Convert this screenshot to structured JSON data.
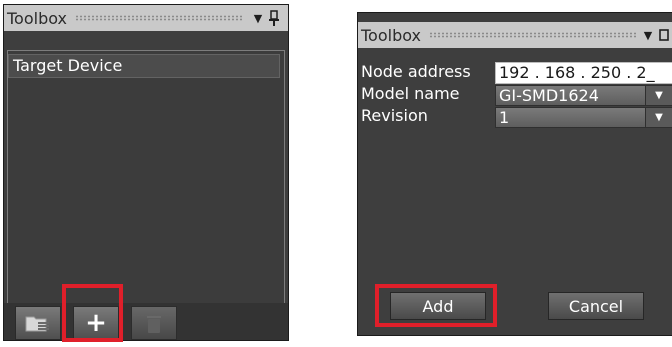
{
  "left_panel": {
    "title": "Toolbox",
    "list_items": [
      "Target Device"
    ],
    "toolbar": {
      "folder_icon": "folder-icon",
      "add_label": "+",
      "delete_icon": "trash-icon"
    },
    "highlight_color": "#e01f2a"
  },
  "right_panel": {
    "title": "Toolbox",
    "fields": {
      "node_address_label": "Node address",
      "node_address_value": "192 . 168 . 250 . 2_",
      "model_name_label": "Model name",
      "model_name_value": "GI-SMD1624",
      "revision_label": "Revision",
      "revision_value": "1"
    },
    "buttons": {
      "add_label": "Add",
      "cancel_label": "Cancel"
    }
  },
  "colors": {
    "panel_bg": "#3e3e3e",
    "titlebar_bg": "#c9c9c9",
    "highlight": "#e01f2a"
  }
}
